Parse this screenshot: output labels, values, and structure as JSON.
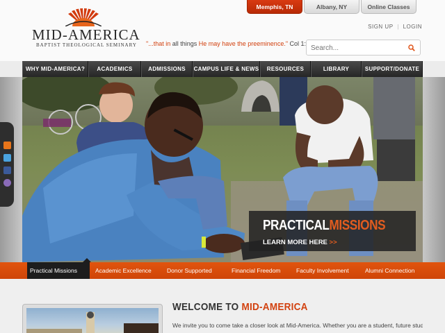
{
  "logo": {
    "name": "MID-AMERICA",
    "subtitle": "BAPTIST THEOLOGICAL SEMINARY"
  },
  "campus_tabs": [
    {
      "label": "Memphis, TN",
      "active": true
    },
    {
      "label": "Albany, NY",
      "active": false
    },
    {
      "label": "Online Classes",
      "active": false
    }
  ],
  "utility_links": {
    "signup": "SIGN UP",
    "separator": "|",
    "login": "LOGIN"
  },
  "tagline": {
    "part1": "\"...that in ",
    "part2": "all things ",
    "part3": "He may have the preeminence.\"",
    "reference": "Col 1:18"
  },
  "search": {
    "placeholder": "Search..."
  },
  "nav": [
    {
      "label": "WHY MID-AMERICA?"
    },
    {
      "label": "ACADEMICS"
    },
    {
      "label": "ADMISSIONS"
    },
    {
      "label": "CAMPUS LIFE & NEWS"
    },
    {
      "label": "RESOURCES"
    },
    {
      "label": "LIBRARY"
    },
    {
      "label": "SUPPORT/DONATE"
    }
  ],
  "social_icons": [
    "rss-icon",
    "twitter-icon",
    "facebook-icon",
    "podcast-icon"
  ],
  "hero": {
    "caption_word1": "PRACTICAL",
    "caption_word2": "MISSIONS",
    "link_label": "LEARN MORE HERE",
    "link_arrow": ">>"
  },
  "slider_tabs": [
    {
      "label": "Practical Missions",
      "active": true
    },
    {
      "label": "Academic Excellence",
      "active": false
    },
    {
      "label": "Donor Supported",
      "active": false
    },
    {
      "label": "Financial Freedom",
      "active": false
    },
    {
      "label": "Faculty Involvement",
      "active": false
    },
    {
      "label": "Alumni Connection",
      "active": false
    }
  ],
  "welcome": {
    "title_part1": "WELCOME TO ",
    "title_part2": "MID-AMERICA",
    "text": "We invite you to come take a closer look at Mid-America.  Whether you are a student, future student,"
  },
  "colors": {
    "accent_orange": "#d84a0c",
    "nav_dark": "#2a2a2a",
    "campus_active": "#c8320a"
  }
}
